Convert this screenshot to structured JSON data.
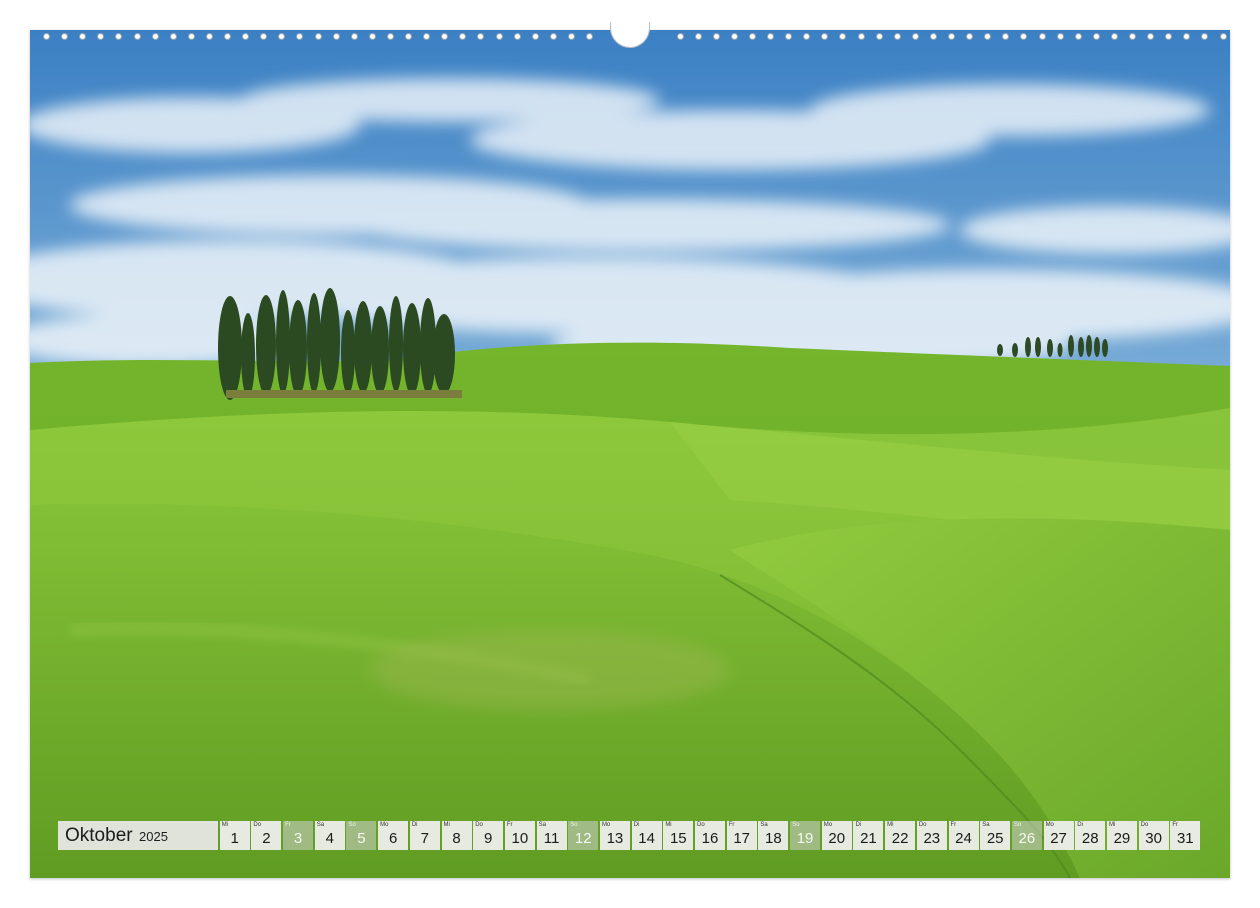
{
  "calendar": {
    "month": "Oktober",
    "year": "2025",
    "days": [
      {
        "wd": "Mi",
        "num": "1",
        "weekend": false
      },
      {
        "wd": "Do",
        "num": "2",
        "weekend": false
      },
      {
        "wd": "Fr",
        "num": "3",
        "weekend": true
      },
      {
        "wd": "Sa",
        "num": "4",
        "weekend": false
      },
      {
        "wd": "So",
        "num": "5",
        "weekend": true
      },
      {
        "wd": "Mo",
        "num": "6",
        "weekend": false
      },
      {
        "wd": "Di",
        "num": "7",
        "weekend": false
      },
      {
        "wd": "Mi",
        "num": "8",
        "weekend": false
      },
      {
        "wd": "Do",
        "num": "9",
        "weekend": false
      },
      {
        "wd": "Fr",
        "num": "10",
        "weekend": false
      },
      {
        "wd": "Sa",
        "num": "11",
        "weekend": false
      },
      {
        "wd": "So",
        "num": "12",
        "weekend": true
      },
      {
        "wd": "Mo",
        "num": "13",
        "weekend": false
      },
      {
        "wd": "Di",
        "num": "14",
        "weekend": false
      },
      {
        "wd": "Mi",
        "num": "15",
        "weekend": false
      },
      {
        "wd": "Do",
        "num": "16",
        "weekend": false
      },
      {
        "wd": "Fr",
        "num": "17",
        "weekend": false
      },
      {
        "wd": "Sa",
        "num": "18",
        "weekend": false
      },
      {
        "wd": "So",
        "num": "19",
        "weekend": true
      },
      {
        "wd": "Mo",
        "num": "20",
        "weekend": false
      },
      {
        "wd": "Di",
        "num": "21",
        "weekend": false
      },
      {
        "wd": "Mi",
        "num": "22",
        "weekend": false
      },
      {
        "wd": "Do",
        "num": "23",
        "weekend": false
      },
      {
        "wd": "Fr",
        "num": "24",
        "weekend": false
      },
      {
        "wd": "Sa",
        "num": "25",
        "weekend": false
      },
      {
        "wd": "So",
        "num": "26",
        "weekend": true
      },
      {
        "wd": "Mo",
        "num": "27",
        "weekend": false
      },
      {
        "wd": "Di",
        "num": "28",
        "weekend": false
      },
      {
        "wd": "Mi",
        "num": "29",
        "weekend": false
      },
      {
        "wd": "Do",
        "num": "30",
        "weekend": false
      },
      {
        "wd": "Fr",
        "num": "31",
        "weekend": false
      }
    ]
  },
  "colors": {
    "sky_top": "#3f86c8",
    "sky_horizon": "#e4eef5",
    "grass_light": "#8cc63a",
    "grass_dark": "#5e9a22",
    "cypress": "#2b4a22"
  },
  "photo": {
    "subject": "rolling green hills with cypress trees"
  }
}
